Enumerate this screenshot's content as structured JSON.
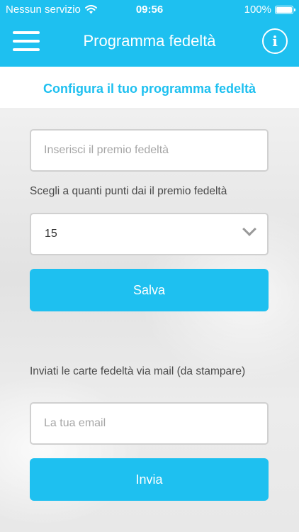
{
  "status_bar": {
    "carrier": "Nessun servizio",
    "time": "09:56",
    "battery": "100%"
  },
  "header": {
    "title": "Programma fedeltà",
    "menu_icon": "hamburger-menu-icon",
    "info_icon": "info-icon",
    "info_glyph": "i"
  },
  "subheader": {
    "title": "Configura il tuo programma fedeltà"
  },
  "form": {
    "reward_placeholder": "Inserisci il premio fedeltà",
    "points_label": "Scegli a quanti punti dai il premio fedeltà",
    "points_value": "15",
    "save_label": "Salva",
    "email_section_label": "Inviati le carte fedeltà via mail (da stampare)",
    "email_placeholder": "La tua email",
    "send_label": "Invia"
  },
  "colors": {
    "accent": "#1ec0f0",
    "background": "#eaeaea"
  }
}
